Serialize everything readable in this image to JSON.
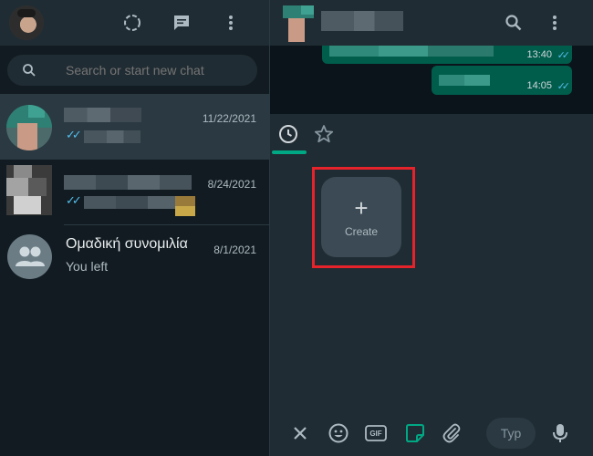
{
  "search": {
    "placeholder": "Search or start new chat"
  },
  "chats": [
    {
      "date": "11/22/2021"
    },
    {
      "date": "8/24/2021"
    },
    {
      "name": "Ομαδική συνομιλία",
      "last": "You left",
      "date": "8/1/2021"
    }
  ],
  "messages": [
    {
      "time": "13:40"
    },
    {
      "time": "14:05"
    }
  ],
  "sticker_panel": {
    "create_label": "Create",
    "create_plus": "+"
  },
  "footer": {
    "gif_label": "GIF",
    "input_placeholder": "Typ"
  },
  "colors": {
    "accent": "#00a884",
    "highlight": "#e5232b",
    "tick": "#53bdeb"
  }
}
